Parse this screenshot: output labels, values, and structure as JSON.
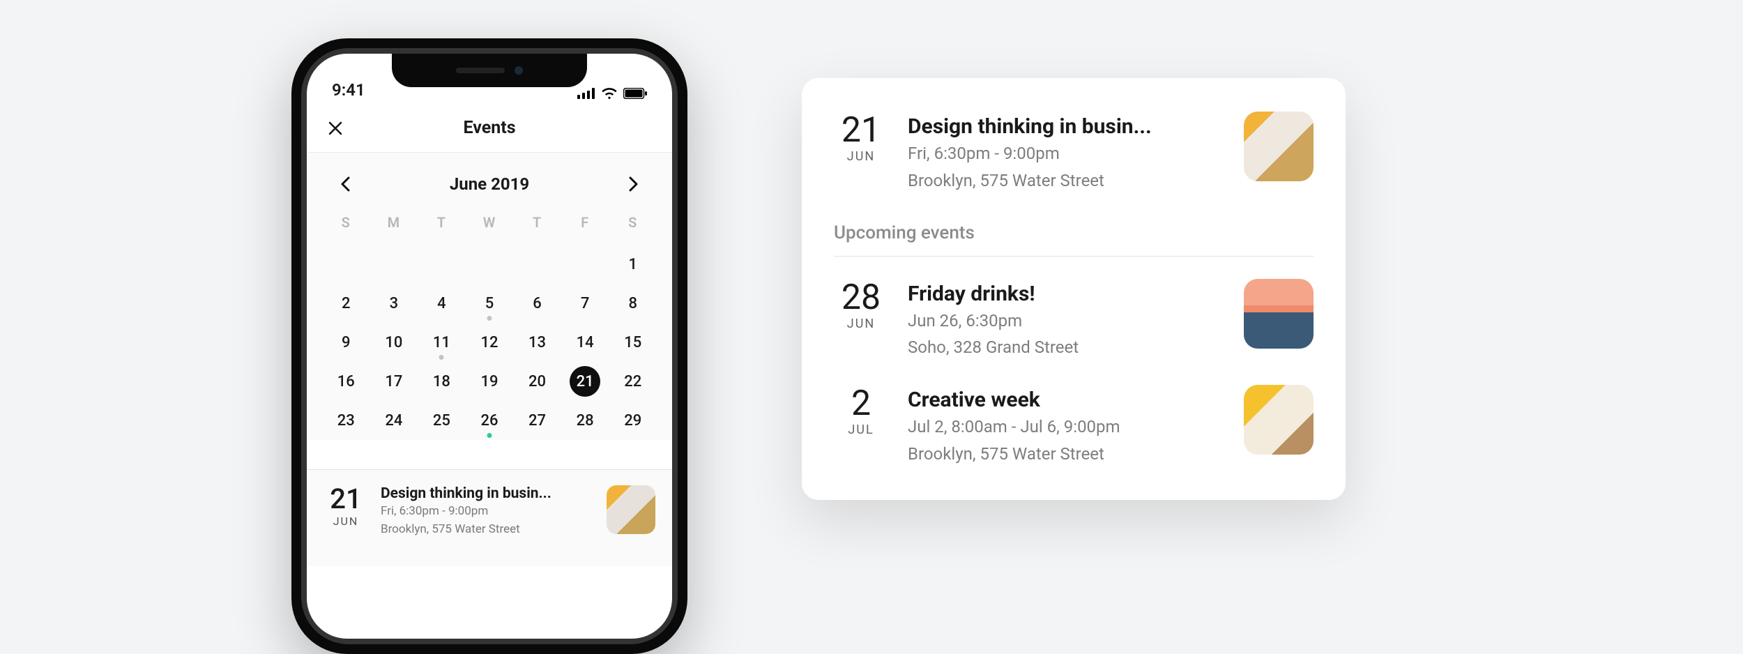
{
  "phone": {
    "status_time": "9:41",
    "nav_title": "Events",
    "month_label": "June 2019",
    "dow": [
      "S",
      "M",
      "T",
      "W",
      "T",
      "F",
      "S"
    ],
    "days": [
      [
        "",
        "",
        "",
        "",
        "",
        "",
        "1"
      ],
      [
        "2",
        "3",
        "4",
        "5",
        "6",
        "7",
        "8"
      ],
      [
        "9",
        "10",
        "11",
        "12",
        "13",
        "14",
        "15"
      ],
      [
        "16",
        "17",
        "18",
        "19",
        "20",
        "21",
        "22"
      ],
      [
        "23",
        "24",
        "25",
        "26",
        "27",
        "28",
        "29"
      ]
    ],
    "selected_day": "21",
    "dot_grey_days": [
      "5",
      "11"
    ],
    "dot_green_days": [
      "26"
    ],
    "event": {
      "day": "21",
      "month": "JUN",
      "title": "Design thinking in busin...",
      "time": "Fri, 6:30pm - 9:00pm",
      "location": "Brooklyn, 575 Water Street"
    }
  },
  "card": {
    "featured": {
      "day": "21",
      "month": "JUN",
      "title": "Design thinking in busin...",
      "time": "Fri, 6:30pm - 9:00pm",
      "location": "Brooklyn, 575 Water Street"
    },
    "section_title": "Upcoming events",
    "upcoming": [
      {
        "day": "28",
        "month": "JUN",
        "title": "Friday drinks!",
        "time": "Jun 26, 6:30pm",
        "location": "Soho, 328 Grand Street"
      },
      {
        "day": "2",
        "month": "JUL",
        "title": "Creative week",
        "time": "Jul 2, 8:00am - Jul 6, 9:00pm",
        "location": "Brooklyn, 575 Water Street"
      }
    ]
  }
}
